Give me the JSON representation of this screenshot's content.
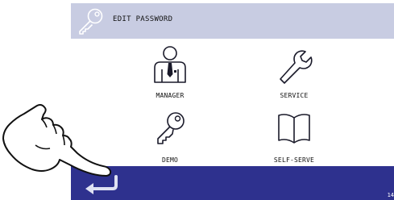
{
  "header": {
    "title": "EDIT PASSWORD",
    "icon": "key-outline-icon"
  },
  "menu": {
    "items": [
      {
        "label": "MANAGER",
        "icon": "manager-person-icon"
      },
      {
        "label": "SERVICE",
        "icon": "wrench-icon"
      },
      {
        "label": "DEMO",
        "icon": "key-icon"
      },
      {
        "label": "SELF-SERVE",
        "icon": "open-book-icon"
      }
    ]
  },
  "footer": {
    "back_icon": "return-arrow-icon",
    "page_number": "14"
  },
  "overlay": {
    "icon": "pointing-hand-icon"
  },
  "colors": {
    "header_bg": "#c8cce2",
    "footer_bg": "#2e318e",
    "icon_stroke": "#1a1a2a"
  }
}
